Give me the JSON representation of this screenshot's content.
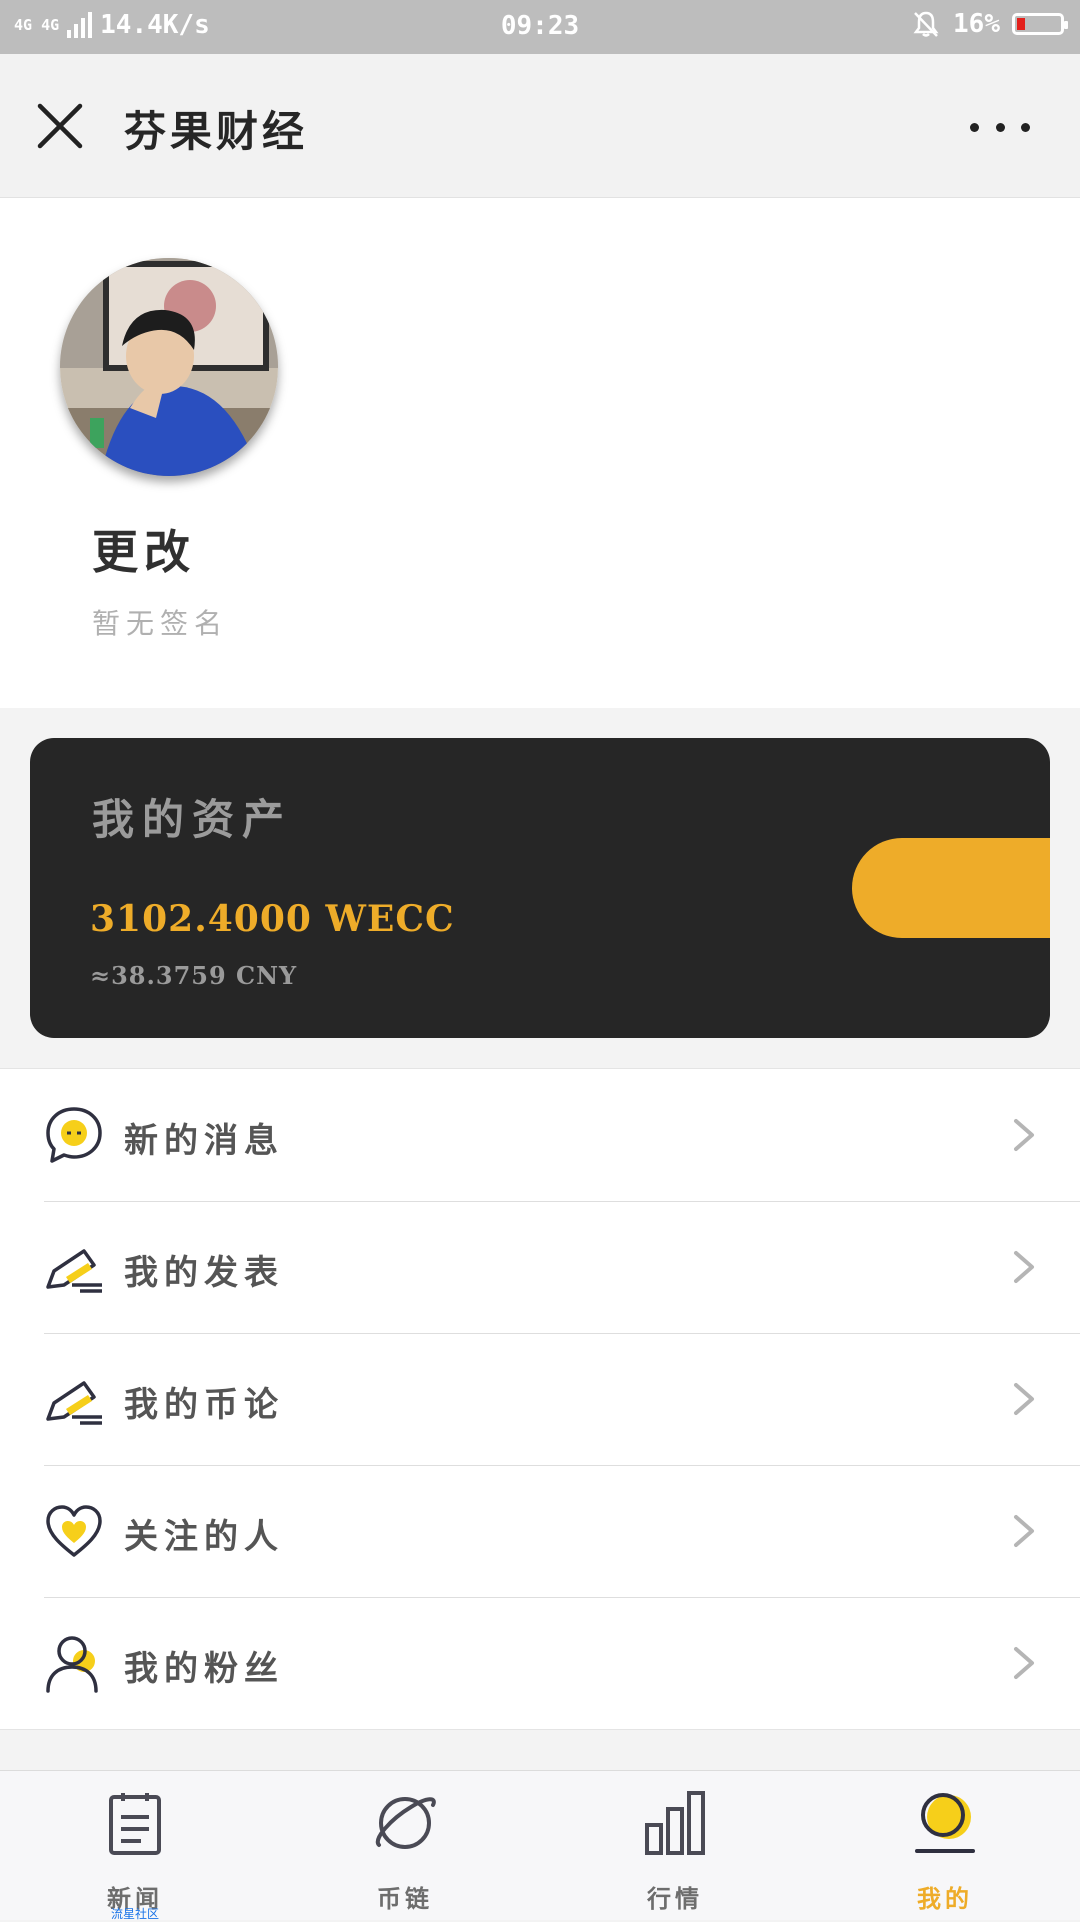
{
  "status_bar": {
    "network": "4G 4G",
    "speed": "14.4K/s",
    "time": "09:23",
    "battery": "16%",
    "battery_level": 0.16,
    "icons": [
      "signal-icon",
      "bell-off-icon",
      "battery-icon"
    ]
  },
  "header": {
    "title": "芬果财经",
    "icons": [
      "close-icon",
      "more-icon"
    ]
  },
  "profile": {
    "username": "更改",
    "signature": "暂无签名",
    "avatar_icon": "avatar-photo"
  },
  "assets": {
    "title": "我的资产",
    "amount": "3102.4000 WECC",
    "cny": "≈38.3759 CNY",
    "accent": "#eeac29"
  },
  "menu": {
    "items": [
      {
        "label": "新的消息",
        "icon": "message-icon"
      },
      {
        "label": "我的发表",
        "icon": "edit-icon"
      },
      {
        "label": "我的币论",
        "icon": "edit-icon"
      },
      {
        "label": "关注的人",
        "icon": "heart-icon"
      },
      {
        "label": "我的粉丝",
        "icon": "user-icon"
      }
    ]
  },
  "tabs": {
    "items": [
      {
        "label": "新闻",
        "icon": "news-icon"
      },
      {
        "label": "币链",
        "icon": "planet-icon"
      },
      {
        "label": "行情",
        "icon": "chart-bars-icon"
      },
      {
        "label": "我的",
        "icon": "profile-icon"
      }
    ],
    "active": 3,
    "watermark": "流星社区"
  },
  "colors": {
    "accent": "#eeac29",
    "card_bg": "#262626",
    "icon_yellow": "#f6cf1a"
  }
}
